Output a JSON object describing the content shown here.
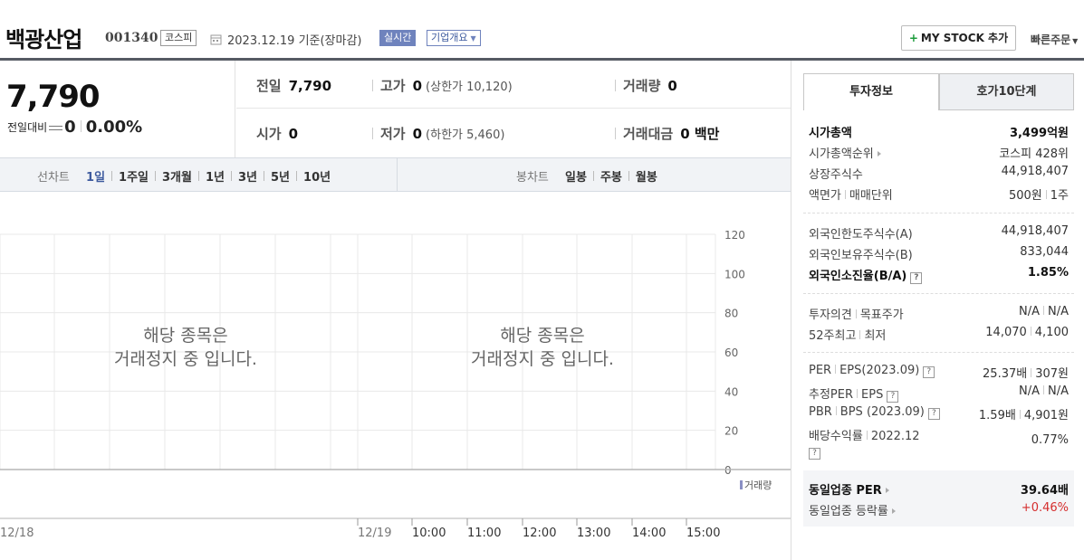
{
  "header": {
    "stock_name": "백광산업",
    "stock_code": "001340",
    "market": "코스피",
    "base_date": "2023.12.19 기준(장마감)",
    "realtime": "실시간",
    "company_overview": "기업개요",
    "mystock_plus": "+",
    "mystock_label": "MY STOCK 추가",
    "quick_order": "빠른주문"
  },
  "price": {
    "current": "7,790",
    "change_label": "전일대비",
    "change_value": "0",
    "change_rate": "0.00%"
  },
  "summary": {
    "prev_close_label": "전일",
    "prev_close": "7,790",
    "high_label": "고가",
    "high": "0",
    "upper_limit": "(상한가 10,120)",
    "volume_label": "거래량",
    "volume": "0",
    "open_label": "시가",
    "open": "0",
    "low_label": "저가",
    "low": "0",
    "lower_limit": "(하한가 5,460)",
    "amount_label": "거래대금",
    "amount": "0 백만"
  },
  "chart_tabs": {
    "line_title": "선차트",
    "line_items": [
      "1일",
      "1주일",
      "3개월",
      "1년",
      "3년",
      "5년",
      "10년"
    ],
    "line_active": "1일",
    "candle_title": "봉차트",
    "candle_items": [
      "일봉",
      "주봉",
      "월봉"
    ]
  },
  "chart": {
    "halt_line1": "해당 종목은",
    "halt_line2": "거래정지 중 입니다.",
    "y_ticks": [
      "120",
      "100",
      "80",
      "60",
      "40",
      "20",
      "0"
    ],
    "volume_legend": "거래량",
    "x_left": [
      "12/18"
    ],
    "x_right": [
      "12/19",
      "10:00",
      "11:00",
      "12:00",
      "13:00",
      "14:00",
      "15:00"
    ],
    "colors": {
      "grid": "#e8e8e8",
      "axis": "#b5b5b5",
      "volume": "#8a8fc4"
    }
  },
  "chart_data": {
    "type": "line",
    "x": [
      "12/18",
      "12/19",
      "10:00",
      "11:00",
      "12:00",
      "13:00",
      "14:00",
      "15:00"
    ],
    "series": [],
    "ylim": [
      0,
      120
    ],
    "grid": true
  },
  "invest_info": {
    "tab_active": "투자정보",
    "tab_inactive": "호가10단계",
    "market_cap_label": "시가총액",
    "market_cap": "3,499억원",
    "market_cap_rank_label": "시가총액순위",
    "market_cap_rank": "코스피 428위",
    "listed_shares_label": "상장주식수",
    "listed_shares": "44,918,407",
    "par_label_a": "액면가",
    "par_label_b": "매매단위",
    "par_value": "500원",
    "trade_unit": "1주",
    "foreign_limit_label": "외국인한도주식수(A)",
    "foreign_limit": "44,918,407",
    "foreign_hold_label": "외국인보유주식수(B)",
    "foreign_hold": "833,044",
    "foreign_ratio_label": "외국인소진율(B/A)",
    "foreign_ratio": "1.85%",
    "opinion_label_a": "투자의견",
    "opinion_label_b": "목표주가",
    "opinion": "N/A",
    "target": "N/A",
    "w52_label_a": "52주최고",
    "w52_label_b": "최저",
    "w52_high": "14,070",
    "w52_low": "4,100",
    "per_label_a": "PER",
    "per_label_b": "EPS",
    "per_period": "(2023.09)",
    "per": "25.37배",
    "eps": "307원",
    "est_per_label_a": "추정PER",
    "est_per_label_b": "EPS",
    "est_per": "N/A",
    "est_eps": "N/A",
    "pbr_label_a": "PBR",
    "pbr_label_b": "BPS",
    "pbr_period": "(2023.09)",
    "pbr": "1.59배",
    "bps": "4,901원",
    "div_label": "배당수익률",
    "div_date": "2022.12",
    "div_yield": "0.77%",
    "sector_per_label": "동일업종 PER",
    "sector_per": "39.64배",
    "sector_rate_label": "동일업종 등락률",
    "sector_rate": "+0.46%",
    "help_mark": "?"
  }
}
